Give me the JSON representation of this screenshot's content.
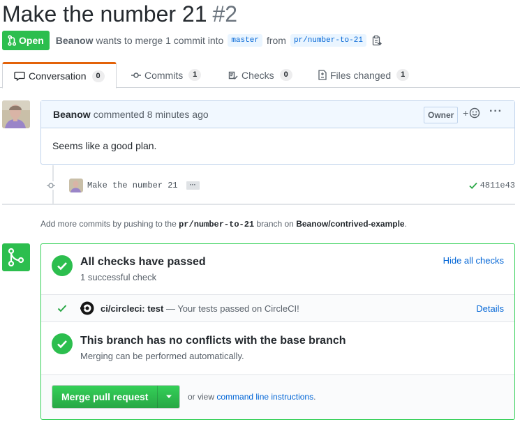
{
  "pr": {
    "title": "Make the number 21",
    "number": "#2",
    "state": "Open",
    "author": "Beanow",
    "merge_text": "wants to merge 1 commit into",
    "base_branch": "master",
    "from_text": "from",
    "head_branch": "pr/number-to-21"
  },
  "tabs": [
    {
      "label": "Conversation",
      "count": "0"
    },
    {
      "label": "Commits",
      "count": "1"
    },
    {
      "label": "Checks",
      "count": "0"
    },
    {
      "label": "Files changed",
      "count": "1"
    }
  ],
  "comment": {
    "author": "Beanow",
    "meta": "commented 8 minutes ago",
    "owner_label": "Owner",
    "reaction": "+",
    "more": "···",
    "body": "Seems like a good plan."
  },
  "commit": {
    "message": "Make the number 21",
    "ellipsis": "···",
    "sha": "4811e43"
  },
  "push_note": {
    "prefix": "Add more commits by pushing to the",
    "branch": "pr/number-to-21",
    "middle": "branch on",
    "repo": "Beanow/contrived-example",
    "suffix": "."
  },
  "checks": {
    "title": "All checks have passed",
    "subtitle": "1 successful check",
    "hide_link": "Hide all checks",
    "ci_name": "ci/circleci: test",
    "ci_desc": "— Your tests passed on CircleCI!",
    "details_link": "Details"
  },
  "conflicts": {
    "title": "This branch has no conflicts with the base branch",
    "subtitle": "Merging can be performed automatically."
  },
  "merge": {
    "button_label": "Merge pull request",
    "alt_prefix": "or view",
    "alt_link": "command line instructions",
    "alt_suffix": "."
  },
  "colors": {
    "success": "#2cbe4e",
    "link": "#0366d6",
    "tab_accent": "#e36209"
  }
}
